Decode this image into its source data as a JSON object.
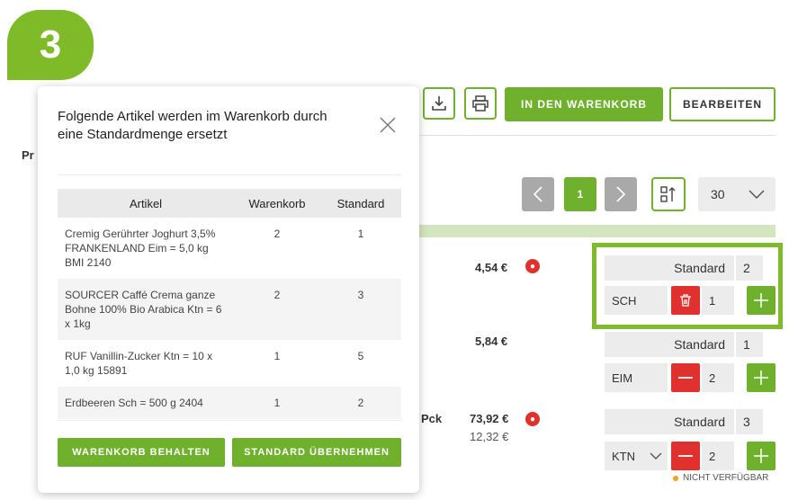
{
  "step_badge": "3",
  "toolbar": {
    "add_to_cart_label": "IN DEN WARENKORB",
    "edit_label": "BEARBEITEN"
  },
  "background": {
    "column_label_partial": "Pr"
  },
  "pagination": {
    "current_page": "1",
    "per_page": "30"
  },
  "products": [
    {
      "price": "4,54 €",
      "standard_label": "Standard",
      "standard_qty": "2",
      "unit": "SCH",
      "qty": "1"
    },
    {
      "price": "5,84 €",
      "standard_label": "Standard",
      "standard_qty": "1",
      "unit": "EIM",
      "qty": "2"
    },
    {
      "pack_label": "Pck",
      "price": "73,92 €",
      "price_sub": "12,32 €",
      "standard_label": "Standard",
      "standard_qty": "3",
      "unit": "KTN",
      "qty": "2",
      "availability": "NICHT VERFÜGBAR"
    }
  ],
  "modal": {
    "title": "Folgende Artikel werden im Warenkorb durch eine Standardmenge ersetzt",
    "columns": [
      "Artikel",
      "Warenkorb",
      "Standard"
    ],
    "rows": [
      {
        "artikel": "Cremig Gerührter Joghurt 3,5% FRANKENLAND Eim = 5,0 kg BMI 2140",
        "warenkorb": "2",
        "standard": "1"
      },
      {
        "artikel": "SOURCER Caffé Crema ganze Bohne 100% Bio Arabica Ktn = 6 x 1kg",
        "warenkorb": "2",
        "standard": "3"
      },
      {
        "artikel": "RUF Vanillin-Zucker Ktn = 10 x 1,0 kg 15891",
        "warenkorb": "1",
        "standard": "5"
      },
      {
        "artikel": "Erdbeeren Sch = 500 g 2404",
        "warenkorb": "1",
        "standard": "2"
      }
    ],
    "keep_button": "WARENKORB BEHALTEN",
    "apply_button": "STANDARD ÜBERNEHMEN"
  },
  "colors": {
    "accent_green": "#6fb12c",
    "badge_green": "#7fbb28",
    "danger_red": "#e0312e",
    "disabled_gray": "#a9a9a9"
  }
}
